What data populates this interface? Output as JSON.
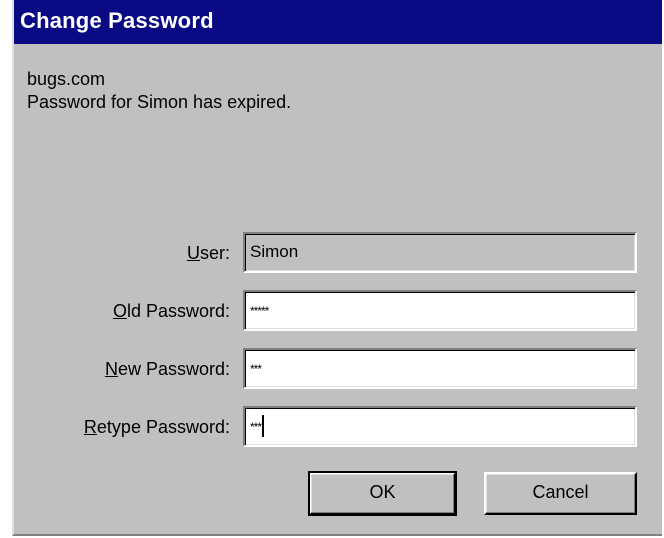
{
  "window": {
    "title": "Change Password"
  },
  "message": {
    "domain": "bugs.com",
    "text": "Password for Simon has expired."
  },
  "fields": {
    "user": {
      "label_accel": "U",
      "label_rest": "ser:",
      "value": "Simon"
    },
    "old_password": {
      "label_accel": "O",
      "label_rest": "ld Password:",
      "value": "*****"
    },
    "new_password": {
      "label_accel": "N",
      "label_rest": "ew Password:",
      "value": "***"
    },
    "retype_password": {
      "label_accel": "R",
      "label_rest": "etype Password:",
      "value": "***"
    }
  },
  "buttons": {
    "ok": "OK",
    "cancel": "Cancel"
  },
  "colors": {
    "titlebar": "#0a0a84",
    "dialog_face": "#c0c0c0"
  }
}
